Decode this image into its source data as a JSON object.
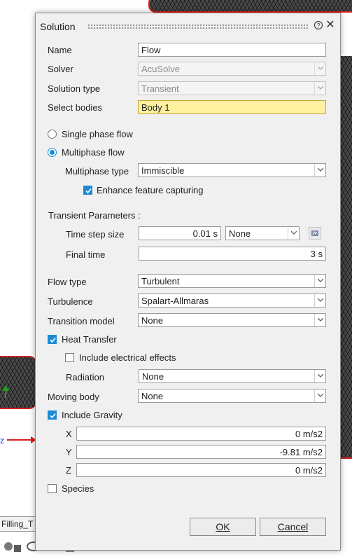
{
  "background": {
    "model_tab_label": "Filling_T"
  },
  "dialog": {
    "title": "Solution",
    "name_label": "Name",
    "name_value": "Flow",
    "solver_label": "Solver",
    "solver_value": "AcuSolve",
    "solution_type_label": "Solution type",
    "solution_type_value": "Transient",
    "select_bodies_label": "Select bodies",
    "select_bodies_value": "Body 1",
    "single_phase_label": "Single phase flow",
    "multiphase_label": "Multiphase flow",
    "multiphase_selected": true,
    "multiphase_type_label": "Multiphase type",
    "multiphase_type_value": "Immiscible",
    "enhance_feature_label": "Enhance feature capturing",
    "enhance_feature_checked": true,
    "transient_params_label": "Transient Parameters :",
    "time_step_label": "Time step size",
    "time_step_value": "0.01 s",
    "time_step_mode": "None",
    "final_time_label": "Final time",
    "final_time_value": "3 s",
    "flow_type_label": "Flow type",
    "flow_type_value": "Turbulent",
    "turbulence_label": "Turbulence",
    "turbulence_value": "Spalart-Allmaras",
    "transition_model_label": "Transition model",
    "transition_model_value": "None",
    "heat_transfer_label": "Heat Transfer",
    "heat_transfer_checked": true,
    "electrical_effects_label": "Include electrical effects",
    "electrical_effects_checked": false,
    "radiation_label": "Radiation",
    "radiation_value": "None",
    "moving_body_label": "Moving body",
    "moving_body_value": "None",
    "gravity_label": "Include Gravity",
    "gravity_checked": true,
    "gravity_x_label": "X",
    "gravity_x_value": "0 m/s2",
    "gravity_y_label": "Y",
    "gravity_y_value": "-9.81 m/s2",
    "gravity_z_label": "Z",
    "gravity_z_value": "0 m/s2",
    "species_label": "Species",
    "species_checked": false,
    "ok_label": "OK",
    "cancel_label": "Cancel"
  },
  "icons": {
    "help": "help-icon",
    "close": "close-icon",
    "dropdown": "chevron-down-icon",
    "units": "units-icon",
    "check": "check-icon"
  },
  "colors": {
    "accent": "#1a8ad4",
    "highlight_field": "#fff1a0",
    "mesh_edge": "#d81d1d",
    "dialog_bg": "#f0f0f0"
  }
}
